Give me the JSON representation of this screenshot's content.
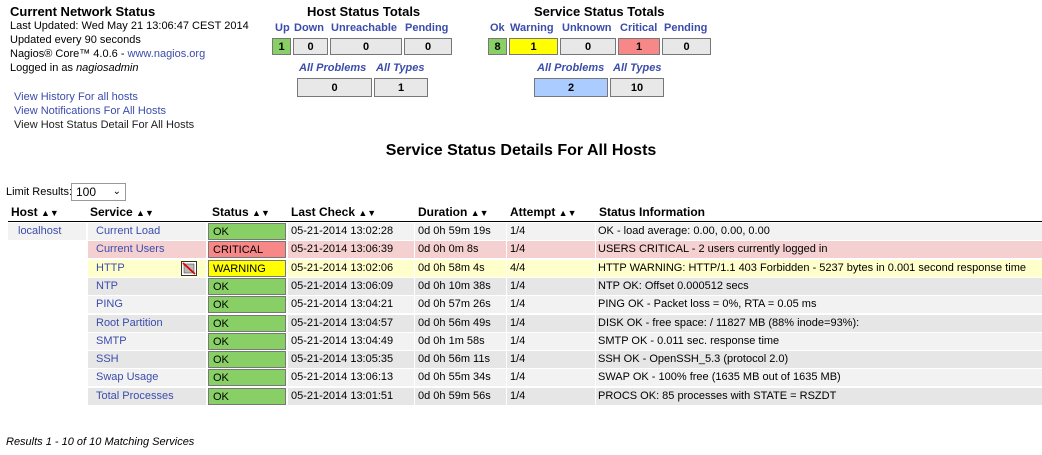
{
  "info": {
    "title": "Current Network Status",
    "last_updated": "Last Updated: Wed May 21 13:06:47 CEST 2014",
    "updated_every": "Updated every 90 seconds",
    "version_prefix": "Nagios® Core™ 4.0.6 - ",
    "version_link": "www.nagios.org",
    "logged_prefix": "Logged in as ",
    "logged_user": "nagiosadmin",
    "links": [
      "View History For all hosts",
      "View Notifications For All Hosts",
      "View Host Status Detail For All Hosts"
    ]
  },
  "host_totals": {
    "title": "Host Status Totals",
    "labels": [
      "Up",
      "Down",
      "Unreachable",
      "Pending"
    ],
    "values": [
      "1",
      "0",
      "0",
      "0"
    ],
    "problems_label": "All Problems",
    "types_label": "All Types",
    "problems": "0",
    "types": "1"
  },
  "service_totals": {
    "title": "Service Status Totals",
    "labels": [
      "Ok",
      "Warning",
      "Unknown",
      "Critical",
      "Pending"
    ],
    "values": [
      "8",
      "1",
      "0",
      "1",
      "0"
    ],
    "problems_label": "All Problems",
    "types_label": "All Types",
    "problems": "2",
    "types": "10"
  },
  "page_title": "Service Status Details For All Hosts",
  "limit": {
    "label": "Limit Results:",
    "value": "100"
  },
  "columns": [
    "Host",
    "Service",
    "Status",
    "Last Check",
    "Duration",
    "Attempt",
    "Status Information"
  ],
  "sort_glyph": "▲▼",
  "host": "localhost",
  "rows": [
    {
      "service": "Current Load",
      "status": "OK",
      "last_check": "05-21-2014 13:02:28",
      "duration": "0d 0h 59m 19s",
      "attempt": "1/4",
      "info": "OK - load average: 0.00, 0.00, 0.00"
    },
    {
      "service": "Current Users",
      "status": "CRITICAL",
      "last_check": "05-21-2014 13:06:39",
      "duration": "0d 0h 0m 8s",
      "attempt": "1/4",
      "info": "USERS CRITICAL - 2 users currently logged in"
    },
    {
      "service": "HTTP",
      "status": "WARNING",
      "last_check": "05-21-2014 13:02:06",
      "duration": "0d 0h 58m 4s",
      "attempt": "4/4",
      "info": "HTTP WARNING: HTTP/1.1 403 Forbidden - 5237 bytes in 0.001 second response time"
    },
    {
      "service": "NTP",
      "status": "OK",
      "last_check": "05-21-2014 13:06:09",
      "duration": "0d 0h 10m 38s",
      "attempt": "1/4",
      "info": "NTP OK: Offset 0.000512 secs"
    },
    {
      "service": "PING",
      "status": "OK",
      "last_check": "05-21-2014 13:04:21",
      "duration": "0d 0h 57m 26s",
      "attempt": "1/4",
      "info": "PING OK - Packet loss = 0%, RTA = 0.05 ms"
    },
    {
      "service": "Root Partition",
      "status": "OK",
      "last_check": "05-21-2014 13:04:57",
      "duration": "0d 0h 56m 49s",
      "attempt": "1/4",
      "info": "DISK OK - free space: / 11827 MB (88% inode=93%):"
    },
    {
      "service": "SMTP",
      "status": "OK",
      "last_check": "05-21-2014 13:04:49",
      "duration": "0d 0h 1m 58s",
      "attempt": "1/4",
      "info": "SMTP OK - 0.011 sec. response time"
    },
    {
      "service": "SSH",
      "status": "OK",
      "last_check": "05-21-2014 13:05:35",
      "duration": "0d 0h 56m 11s",
      "attempt": "1/4",
      "info": "SSH OK - OpenSSH_5.3 (protocol 2.0)"
    },
    {
      "service": "Swap Usage",
      "status": "OK",
      "last_check": "05-21-2014 13:06:13",
      "duration": "0d 0h 55m 34s",
      "attempt": "1/4",
      "info": "SWAP OK - 100% free (1635 MB out of 1635 MB)"
    },
    {
      "service": "Total Processes",
      "status": "OK",
      "last_check": "05-21-2014 13:01:51",
      "duration": "0d 0h 59m 56s",
      "attempt": "1/4",
      "info": "PROCS OK: 85 processes with STATE = RSZDT"
    }
  ],
  "http_icon": "notifications-disabled-icon",
  "footer": "Results 1 - 10 of 10 Matching Services"
}
